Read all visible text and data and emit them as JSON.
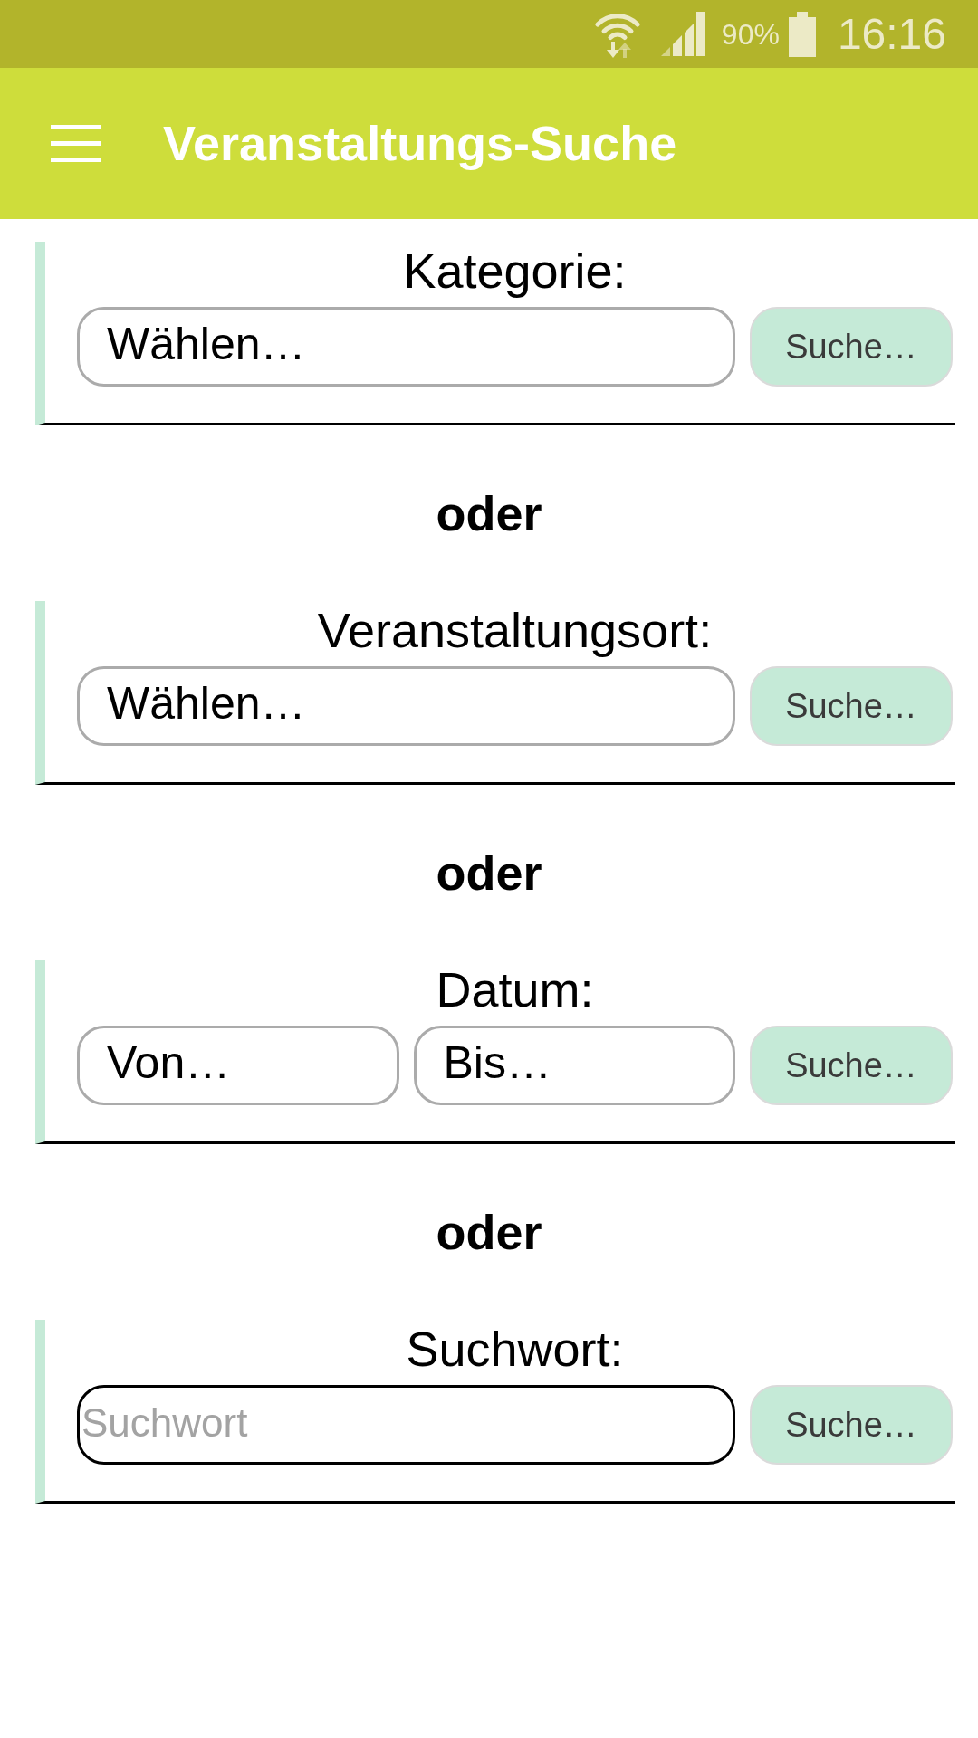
{
  "status_bar": {
    "battery": "90%",
    "time": "16:16"
  },
  "app_bar": {
    "title": "Veranstaltungs-Suche"
  },
  "blocks": [
    {
      "kind": "section",
      "label": "Kategorie:",
      "fields": [
        {
          "kind": "select",
          "value": "Wählen…",
          "focused": false
        }
      ],
      "button": "Suche…"
    },
    {
      "kind": "separator",
      "text": "oder"
    },
    {
      "kind": "section",
      "label": "Veranstaltungsort:",
      "fields": [
        {
          "kind": "select",
          "value": "Wählen…",
          "focused": false
        }
      ],
      "button": "Suche…"
    },
    {
      "kind": "separator",
      "text": "oder"
    },
    {
      "kind": "section",
      "label": "Datum:",
      "fields": [
        {
          "kind": "select",
          "value": "Von…",
          "focused": false
        },
        {
          "kind": "select",
          "value": "Bis…",
          "focused": false
        }
      ],
      "button": "Suche…"
    },
    {
      "kind": "separator",
      "text": "oder"
    },
    {
      "kind": "section",
      "label": "Suchwort:",
      "fields": [
        {
          "kind": "text",
          "placeholder": "Suchwort",
          "focused": true
        }
      ],
      "button": "Suche…"
    }
  ]
}
